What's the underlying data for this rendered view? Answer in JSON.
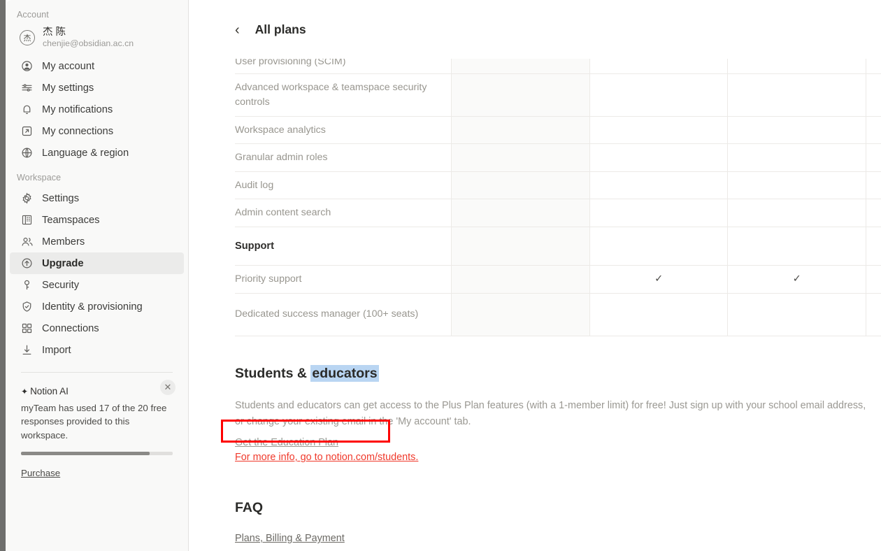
{
  "sidebar": {
    "account_section_label": "Account",
    "account": {
      "avatar_initial": "杰",
      "name": "杰 陈",
      "email": "chenjie@obsidian.ac.cn"
    },
    "account_items": [
      {
        "label": "My account",
        "icon": "user-circle-icon"
      },
      {
        "label": "My settings",
        "icon": "sliders-icon"
      },
      {
        "label": "My notifications",
        "icon": "bell-icon"
      },
      {
        "label": "My connections",
        "icon": "arrow-out-box-icon"
      },
      {
        "label": "Language & region",
        "icon": "globe-icon"
      }
    ],
    "workspace_section_label": "Workspace",
    "workspace_items": [
      {
        "label": "Settings",
        "icon": "gear-icon",
        "active": false
      },
      {
        "label": "Teamspaces",
        "icon": "building-icon",
        "active": false
      },
      {
        "label": "Members",
        "icon": "people-icon",
        "active": false
      },
      {
        "label": "Upgrade",
        "icon": "arrow-up-circle-icon",
        "active": true
      },
      {
        "label": "Security",
        "icon": "key-icon",
        "active": false
      },
      {
        "label": "Identity & provisioning",
        "icon": "shield-check-icon",
        "active": false
      },
      {
        "label": "Connections",
        "icon": "grid-squares-icon",
        "active": false
      },
      {
        "label": "Import",
        "icon": "download-icon",
        "active": false
      }
    ],
    "notion_ai": {
      "spark_icon": "sparkle-icon",
      "title": "Notion AI",
      "close_label": "✕",
      "description": "myTeam has used 17 of the 20 free responses provided to this workspace.",
      "progress_percent": 85,
      "purchase_label": "Purchase"
    }
  },
  "header": {
    "back_icon": "chevron-left-icon",
    "title": "All plans"
  },
  "table": {
    "check_glyph": "✓",
    "rows": [
      {
        "label": "User provisioning (SCIM)",
        "type": "feature",
        "clipped": true,
        "tall": false,
        "checks": [
          false,
          false,
          false,
          true
        ]
      },
      {
        "label": "Advanced workspace & teamspace security controls",
        "type": "feature",
        "clipped": false,
        "tall": true,
        "checks": [
          false,
          false,
          false,
          true
        ]
      },
      {
        "label": "Workspace analytics",
        "type": "feature",
        "clipped": false,
        "tall": false,
        "checks": [
          false,
          false,
          false,
          true
        ]
      },
      {
        "label": "Granular admin roles",
        "type": "feature",
        "clipped": false,
        "tall": false,
        "checks": [
          false,
          false,
          false,
          true
        ]
      },
      {
        "label": "Audit log",
        "type": "feature",
        "clipped": false,
        "tall": false,
        "checks": [
          false,
          false,
          false,
          true
        ]
      },
      {
        "label": "Admin content search",
        "type": "feature",
        "clipped": false,
        "tall": false,
        "checks": [
          false,
          false,
          false,
          true
        ]
      },
      {
        "label": "Support",
        "type": "group",
        "clipped": false,
        "tall": false,
        "checks": [
          false,
          false,
          false,
          false
        ]
      },
      {
        "label": "Priority support",
        "type": "feature",
        "clipped": false,
        "tall": false,
        "checks": [
          false,
          true,
          true,
          true
        ]
      },
      {
        "label": "Dedicated success manager (100+ seats)",
        "type": "feature",
        "clipped": false,
        "tall": true,
        "checks": [
          false,
          false,
          false,
          true
        ]
      }
    ]
  },
  "students": {
    "heading_plain": "Students & ",
    "heading_highlighted": "educators",
    "paragraph": "Students and educators can get access to the Plus Plan features (with a 1-member limit) for free! Just sign up with your school email address, or change your existing email in the 'My account' tab.",
    "education_plan_link": "Get the Education Plan",
    "more_info_link": "For more info, go to notion.com/students."
  },
  "faq": {
    "heading": "FAQ",
    "links": [
      {
        "label": "Plans, Billing & Payment"
      }
    ]
  },
  "colors": {
    "annotation_red": "#fe0000",
    "highlight_blue": "#b9d5f2",
    "sidebar_bg": "#f9f9f8",
    "active_item_bg": "#ebebea"
  }
}
